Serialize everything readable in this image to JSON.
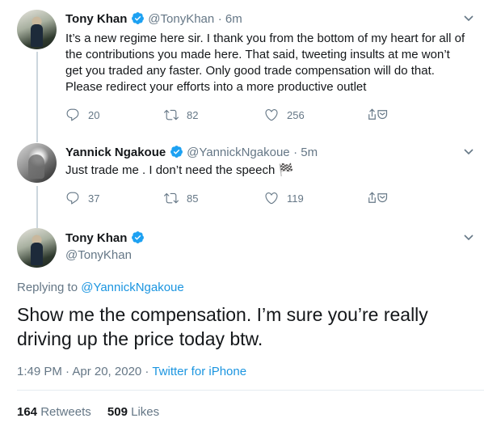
{
  "tweets": [
    {
      "name": "Tony Khan",
      "handle": "@TonyKhan",
      "time": "· 6m",
      "text": "It’s a new regime here sir. I thank you from the bottom of my heart for all of the contributions you made here. That said, tweeting insults at me won’t get you traded any faster. Only good trade compensation will do that. Please redirect your efforts into a more productive outlet",
      "replies": "20",
      "retweets": "82",
      "likes": "256"
    },
    {
      "name": "Yannick Ngakoue",
      "handle": "@YannickNgakoue",
      "time": "· 5m",
      "text": "Just trade me . I don’t need the speech 🏁",
      "replies": "37",
      "retweets": "85",
      "likes": "119"
    }
  ],
  "main_tweet": {
    "name": "Tony Khan",
    "handle": "@TonyKhan",
    "replying_prefix": "Replying to",
    "replying_to": "@YannickNgakoue",
    "text": "Show me the compensation. I’m sure you’re really driving up the price today btw.",
    "datetime": "1:49 PM · Apr 20, 2020 ·",
    "source": "Twitter for iPhone",
    "retweet_count": "164",
    "retweet_label": "Retweets",
    "like_count": "509",
    "like_label": "Likes"
  },
  "colors": {
    "accent": "#1b95e0",
    "text": "#14171a",
    "secondary": "#657786",
    "divider": "#e6ecf0"
  },
  "icons": [
    "verified-badge-icon",
    "reply-icon",
    "retweet-icon",
    "like-icon",
    "share-icon",
    "chevron-down-icon"
  ]
}
